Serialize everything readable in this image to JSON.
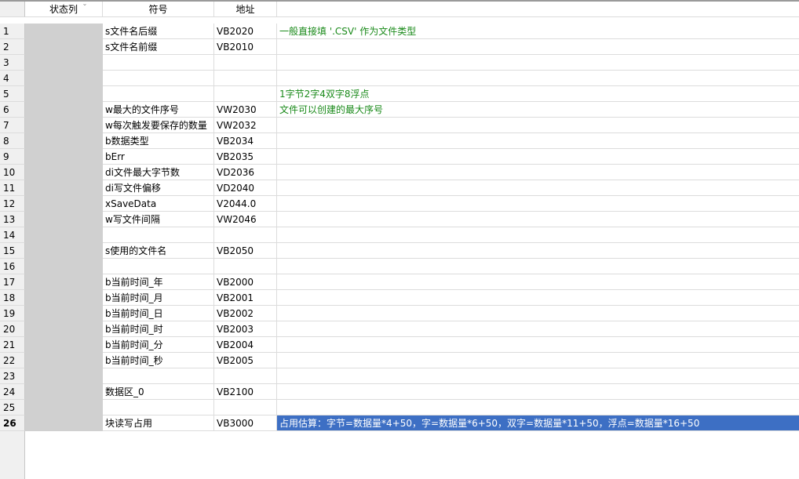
{
  "headers": {
    "status": "状态列",
    "symbol": "符号",
    "address": "地址",
    "comment": ""
  },
  "rows": [
    {
      "n": "1",
      "symbol": "s文件名后缀",
      "address": "VB2020",
      "comment": "一般直接填 '.CSV' 作为文件类型"
    },
    {
      "n": "2",
      "symbol": "s文件名前缀",
      "address": "VB2010",
      "comment": ""
    },
    {
      "n": "3",
      "symbol": "",
      "address": "",
      "comment": ""
    },
    {
      "n": "4",
      "symbol": "",
      "address": "",
      "comment": ""
    },
    {
      "n": "5",
      "symbol": "",
      "address": "",
      "comment": "1字节2字4双字8浮点"
    },
    {
      "n": "6",
      "symbol": "w最大的文件序号",
      "address": "VW2030",
      "comment": "文件可以创建的最大序号"
    },
    {
      "n": "7",
      "symbol": "w每次触发要保存的数量",
      "address": "VW2032",
      "comment": ""
    },
    {
      "n": "8",
      "symbol": "b数据类型",
      "address": "VB2034",
      "comment": ""
    },
    {
      "n": "9",
      "symbol": "bErr",
      "address": "VB2035",
      "comment": ""
    },
    {
      "n": "10",
      "symbol": "di文件最大字节数",
      "address": "VD2036",
      "comment": ""
    },
    {
      "n": "11",
      "symbol": "di写文件偏移",
      "address": "VD2040",
      "comment": ""
    },
    {
      "n": "12",
      "symbol": "xSaveData",
      "address": "V2044.0",
      "comment": ""
    },
    {
      "n": "13",
      "symbol": "w写文件间隔",
      "address": "VW2046",
      "comment": ""
    },
    {
      "n": "14",
      "symbol": "",
      "address": "",
      "comment": ""
    },
    {
      "n": "15",
      "symbol": "s使用的文件名",
      "address": "VB2050",
      "comment": ""
    },
    {
      "n": "16",
      "symbol": "",
      "address": "",
      "comment": ""
    },
    {
      "n": "17",
      "symbol": "b当前时间_年",
      "address": "VB2000",
      "comment": ""
    },
    {
      "n": "18",
      "symbol": "b当前时间_月",
      "address": "VB2001",
      "comment": ""
    },
    {
      "n": "19",
      "symbol": "b当前时间_日",
      "address": "VB2002",
      "comment": ""
    },
    {
      "n": "20",
      "symbol": "b当前时间_时",
      "address": "VB2003",
      "comment": ""
    },
    {
      "n": "21",
      "symbol": "b当前时间_分",
      "address": "VB2004",
      "comment": ""
    },
    {
      "n": "22",
      "symbol": "b当前时间_秒",
      "address": "VB2005",
      "comment": ""
    },
    {
      "n": "23",
      "symbol": "",
      "address": "",
      "comment": ""
    },
    {
      "n": "24",
      "symbol": "数据区_0",
      "address": "VB2100",
      "comment": ""
    },
    {
      "n": "25",
      "symbol": "",
      "address": "",
      "comment": ""
    },
    {
      "n": "26",
      "symbol": "块读写占用",
      "address": "VB3000",
      "comment": "占用估算：字节=数据量*4+50，字=数据量*6+50，双字=数据量*11+50，浮点=数据量*16+50"
    }
  ],
  "selected_row": "26",
  "colors": {
    "comment_text": "#1a8a1a",
    "selection": "#3d6fc4",
    "status_fill": "#d0d0d0"
  }
}
